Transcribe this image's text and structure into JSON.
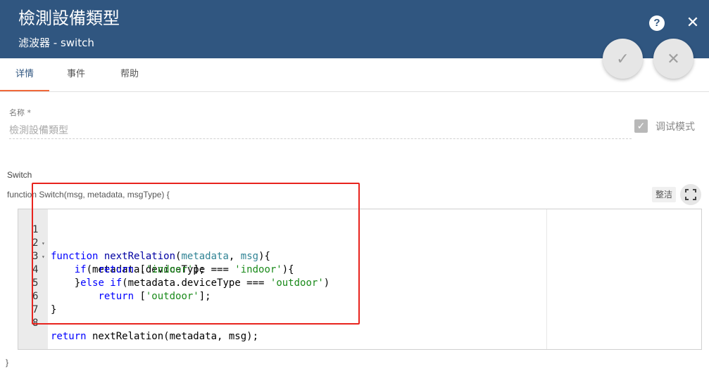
{
  "header": {
    "title": "檢測設備類型",
    "subtitle": "滤波器 - switch",
    "help_icon": "?",
    "close_icon": "✕",
    "background": "#305680"
  },
  "actions": {
    "confirm_icon": "✓",
    "cancel_icon": "✕"
  },
  "tabs": [
    {
      "label": "详情",
      "active": true
    },
    {
      "label": "事件",
      "active": false
    },
    {
      "label": "帮助",
      "active": false
    }
  ],
  "form": {
    "name_label": "名称 *",
    "name_value": "檢測設備類型",
    "debug_check": "✓",
    "debug_label": "调试模式",
    "debug_checked": true
  },
  "script": {
    "section_label": "Switch",
    "signature": "function Switch(msg, metadata, msgType) {",
    "tidy_label": "整洁",
    "closing": "}"
  },
  "editor": {
    "line_numbers": [
      "1",
      "2",
      "3",
      "4",
      "5",
      "6",
      "7",
      "8"
    ],
    "fold_markers": [
      "▾",
      "▾"
    ],
    "tokens": {
      "l1_kw": "function",
      "l1_fn": "nextRelation",
      "l1_p1": "metadata",
      "l1_sep": ", ",
      "l1_p2": "msg",
      "l1_tail": "){",
      "l2_indent": "    ",
      "l2_kw": "if",
      "l2_mid": "(metadata.deviceType === ",
      "l2_str": "'indoor'",
      "l2_tail": "){",
      "l3_indent": "        ",
      "l3_kw": "return",
      "l3_mid": " [",
      "l3_str": "'indoor'",
      "l3_tail": "];",
      "l4_pre": "    }",
      "l4_kw": "else if",
      "l4_mid": "(metadata.deviceType === ",
      "l4_str": "'outdoor'",
      "l4_tail": ")",
      "l5_indent": "        ",
      "l5_kw": "return",
      "l5_mid": " [",
      "l5_str": "'outdoor'",
      "l5_tail": "];",
      "l6": "}",
      "l8_kw": "return",
      "l8_rest": " nextRelation(metadata, msg);"
    }
  },
  "colors": {
    "accent_tab": "#f0693a",
    "highlight_box": "#e8231d"
  }
}
